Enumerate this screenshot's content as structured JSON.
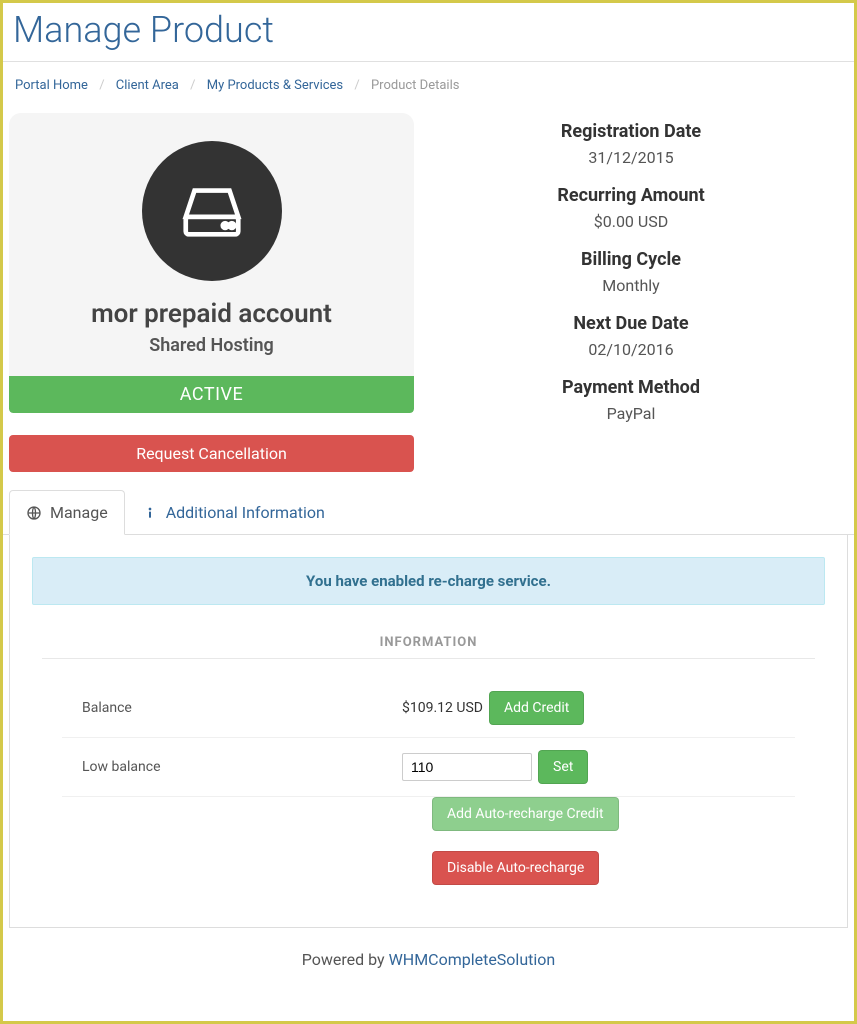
{
  "page_title": "Manage Product",
  "breadcrumb": {
    "home": "Portal Home",
    "client_area": "Client Area",
    "products": "My Products & Services",
    "current": "Product Details"
  },
  "product": {
    "name": "mor prepaid account",
    "group": "Shared Hosting",
    "status": "ACTIVE"
  },
  "cancel_button": "Request Cancellation",
  "details": {
    "reg_date_label": "Registration Date",
    "reg_date_value": "31/12/2015",
    "recurring_label": "Recurring Amount",
    "recurring_value": "$0.00 USD",
    "cycle_label": "Billing Cycle",
    "cycle_value": "Monthly",
    "due_label": "Next Due Date",
    "due_value": "02/10/2016",
    "payment_label": "Payment Method",
    "payment_value": "PayPal"
  },
  "tabs": {
    "manage": "Manage",
    "additional": "Additional Information"
  },
  "alert_message": "You have enabled re-charge service.",
  "info_header": "INFORMATION",
  "balance": {
    "label": "Balance",
    "value": "$109.12 USD",
    "add_button": "Add Credit"
  },
  "low_balance": {
    "label": "Low balance",
    "value": "110",
    "set_button": "Set"
  },
  "actions": {
    "add_auto": "Add Auto-recharge Credit",
    "disable_auto": "Disable Auto-recharge"
  },
  "footer": {
    "powered_by": "Powered by ",
    "link_text": "WHMCompleteSolution"
  }
}
